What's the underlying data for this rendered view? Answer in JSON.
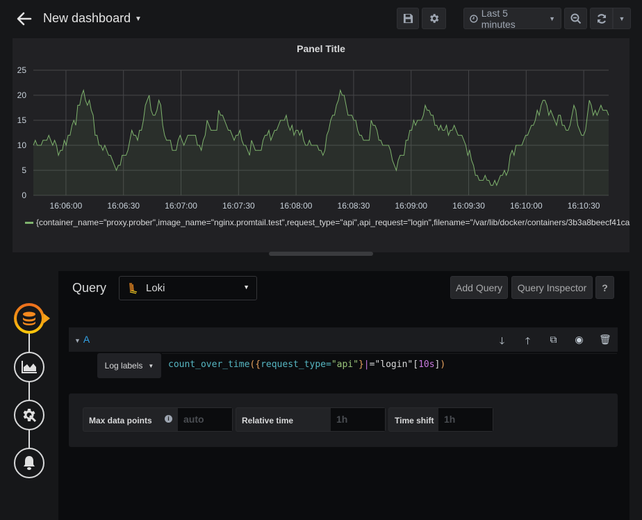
{
  "header": {
    "title": "New dashboard",
    "time_range": "Last 5 minutes"
  },
  "panel": {
    "title": "Panel Title",
    "legend": "{container_name=\"proxy.prober\",image_name=\"nginx.promtail.test\",request_type=\"api\",api_request=\"login\",filename=\"/var/lib/docker/containers/3b3a8beecf41ca"
  },
  "editor": {
    "query_label": "Query",
    "datasource": "Loki",
    "add_query_label": "Add Query",
    "query_inspector_label": "Query Inspector",
    "help_label": "?",
    "query_ref": "A",
    "log_labels_label": "Log labels",
    "query_tokens": [
      {
        "text": "count_over_time",
        "color": "#56b6c2"
      },
      {
        "text": "(",
        "color": "#e5a15d"
      },
      {
        "text": "{",
        "color": "#e5a15d"
      },
      {
        "text": "request_type",
        "color": "#56b6c2"
      },
      {
        "text": "=",
        "color": "#56b6c2"
      },
      {
        "text": "\"api\"",
        "color": "#98c379"
      },
      {
        "text": "}",
        "color": "#e5a15d"
      },
      {
        "text": "|",
        "color": "#c678dd"
      },
      {
        "text": "=\"login\"",
        "color": "#d8d9da"
      },
      {
        "text": "[",
        "color": "#d8d9da"
      },
      {
        "text": "10s",
        "color": "#c678dd"
      },
      {
        "text": "]",
        "color": "#d8d9da"
      },
      {
        "text": ")",
        "color": "#e5a15d"
      }
    ],
    "options": {
      "max_data_points_label": "Max data points",
      "max_data_points_placeholder": "auto",
      "relative_time_label": "Relative time",
      "relative_time_placeholder": "1h",
      "time_shift_label": "Time shift",
      "time_shift_placeholder": "1h"
    }
  },
  "sidebar": {
    "items": [
      {
        "name": "queries",
        "icon": "database-icon",
        "active": true
      },
      {
        "name": "visualization",
        "icon": "area-chart-icon",
        "active": false
      },
      {
        "name": "general",
        "icon": "cog-wrench-icon",
        "active": false
      },
      {
        "name": "alert",
        "icon": "bell-icon",
        "active": false
      }
    ]
  },
  "colors": {
    "series": "#7eb26d",
    "accent_start": "#eb6b1e",
    "accent_end": "#fbca0a",
    "query_ref": "#33a2e5"
  },
  "chart_data": {
    "type": "area",
    "title": "Panel Title",
    "xlabel": "",
    "ylabel": "",
    "ylim": [
      0,
      25
    ],
    "yticks": [
      0,
      5,
      10,
      15,
      20,
      25
    ],
    "xticks": [
      "16:06:00",
      "16:06:30",
      "16:07:00",
      "16:07:30",
      "16:08:00",
      "16:08:30",
      "16:09:00",
      "16:09:30",
      "16:10:00",
      "16:10:30"
    ],
    "x_start": "16:05:43",
    "x_end": "16:10:43",
    "x_step_seconds": 2,
    "grid": true,
    "legend_position": "bottom",
    "series": [
      {
        "name": "{container_name=\"proxy.prober\",image_name=\"nginx.promtail.test\",request_type=\"api\",api_request=\"login\",filename=\"/var/lib/docker/containers/3b3a8beecf41ca",
        "values": [
          10,
          11,
          10,
          10,
          10,
          11,
          11,
          11,
          12,
          11,
          10,
          11,
          10,
          8,
          9,
          9,
          11,
          10,
          12,
          12,
          14,
          15,
          14,
          18,
          18,
          20,
          21,
          19,
          18,
          19,
          17,
          16,
          12,
          12,
          10,
          10,
          9,
          10,
          9,
          8,
          8,
          7,
          6,
          5,
          6,
          6,
          8,
          8,
          8,
          9,
          11,
          13,
          12,
          12,
          11,
          13,
          13,
          15,
          18,
          19,
          20,
          17,
          16,
          16,
          17,
          19,
          18,
          14,
          12,
          11,
          11,
          11,
          9,
          9,
          9,
          11,
          12,
          11,
          10,
          11,
          12,
          12,
          12,
          12,
          12,
          10,
          10,
          9,
          11,
          12,
          15,
          14,
          13,
          13,
          13,
          13,
          17,
          16,
          16,
          15,
          14,
          13,
          13,
          12,
          11,
          12,
          12,
          13,
          11,
          10,
          10,
          9,
          8,
          11,
          10,
          9,
          9,
          9,
          9,
          11,
          12,
          12,
          13,
          11,
          12,
          13,
          13,
          14,
          15,
          15,
          15,
          16,
          14,
          13,
          14,
          12,
          13,
          13,
          12,
          13,
          11,
          10,
          10,
          11,
          10,
          10,
          10,
          10,
          9,
          9,
          8,
          9,
          12,
          13,
          15,
          16,
          16,
          18,
          19,
          21,
          20,
          20,
          18,
          16,
          16,
          16,
          15,
          15,
          13,
          12,
          12,
          11,
          11,
          11,
          11,
          15,
          14,
          14,
          13,
          11,
          11,
          10,
          10,
          10,
          10,
          9,
          7,
          6,
          5,
          7,
          8,
          8,
          8,
          11,
          11,
          13,
          13,
          15,
          14,
          15,
          15,
          15,
          16,
          18,
          17,
          17,
          16,
          16,
          14,
          14,
          13,
          14,
          13,
          13,
          14,
          12,
          13,
          13,
          14,
          13,
          12,
          12,
          12,
          11,
          10,
          8,
          9,
          7,
          6,
          4,
          4,
          3,
          3,
          3,
          4,
          3,
          3,
          2,
          2,
          3,
          2,
          3,
          4,
          4,
          5,
          4,
          5,
          8,
          9,
          8,
          10,
          10,
          10,
          10,
          11,
          12,
          12,
          13,
          14,
          14,
          15,
          17,
          16,
          18,
          19,
          19,
          18,
          16,
          17,
          16,
          15,
          14,
          16,
          16,
          14,
          14,
          13,
          13,
          14,
          16,
          18,
          17,
          14,
          13,
          12,
          12,
          13,
          16,
          19,
          18,
          16,
          17,
          16,
          17,
          18,
          17,
          17,
          17,
          16
        ]
      }
    ]
  }
}
